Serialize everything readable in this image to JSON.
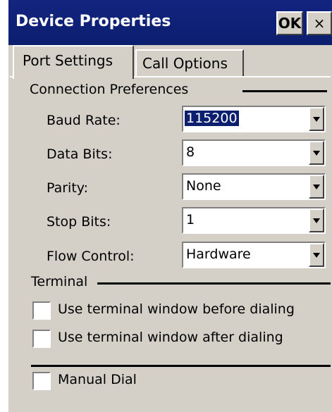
{
  "window": {
    "title": "Device Properties",
    "ok_label": "OK",
    "close_label": "×"
  },
  "tabs": [
    {
      "label": "Port Settings",
      "active": true
    },
    {
      "label": "Call Options",
      "active": false
    }
  ],
  "connection": {
    "group_label": "Connection Preferences",
    "fields": [
      {
        "label": "Baud Rate:",
        "value": "115200",
        "selected": true
      },
      {
        "label": "Data Bits:",
        "value": "8"
      },
      {
        "label": "Parity:",
        "value": "None"
      },
      {
        "label": "Stop Bits:",
        "value": "1"
      },
      {
        "label": "Flow Control:",
        "value": "Hardware"
      }
    ]
  },
  "terminal": {
    "group_label": "Terminal",
    "options": [
      {
        "label": "Use terminal window before dialing",
        "checked": false
      },
      {
        "label": "Use terminal window after dialing",
        "checked": false
      }
    ]
  },
  "manual_dial": {
    "label": "Manual Dial",
    "checked": false
  }
}
